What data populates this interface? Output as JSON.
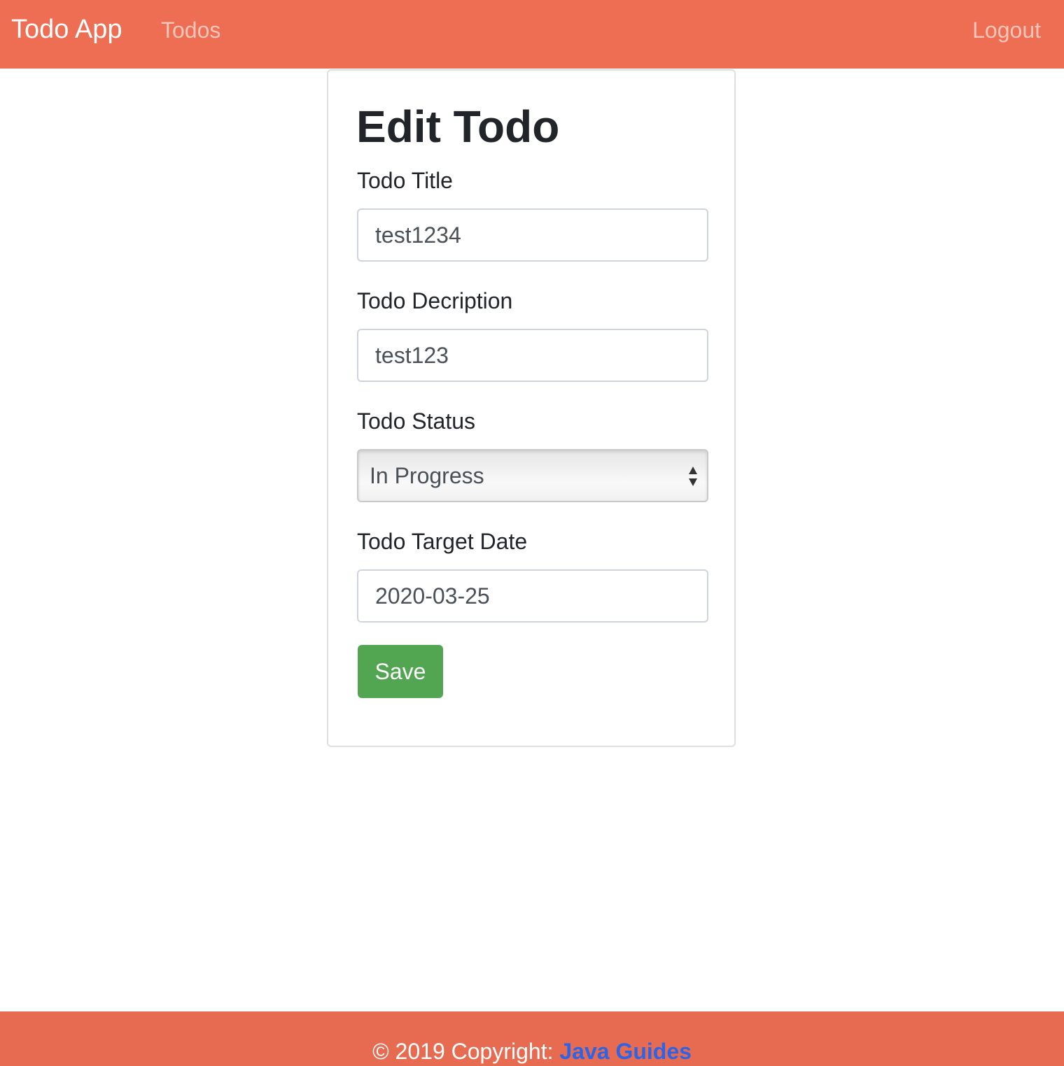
{
  "navbar": {
    "brand": "Todo App",
    "nav_items": [
      {
        "label": "Todos"
      }
    ],
    "logout_label": "Logout"
  },
  "form": {
    "heading": "Edit Todo",
    "title_label": "Todo Title",
    "title_value": "test1234",
    "description_label": "Todo Decription",
    "description_value": "test123",
    "status_label": "Todo Status",
    "status_value": "In Progress",
    "target_date_label": "Todo Target Date",
    "target_date_value": "2020-03-25",
    "save_label": "Save"
  },
  "footer": {
    "copyright_text": "© 2019 Copyright: ",
    "link_text": "Java Guides"
  },
  "colors": {
    "navbar_bg": "#ed6e53",
    "footer_bg": "#e76b50",
    "save_button_bg": "#52a651",
    "footer_link": "#2d64e6"
  },
  "icons": {
    "select_arrows": "chevron-up-down-icon"
  }
}
